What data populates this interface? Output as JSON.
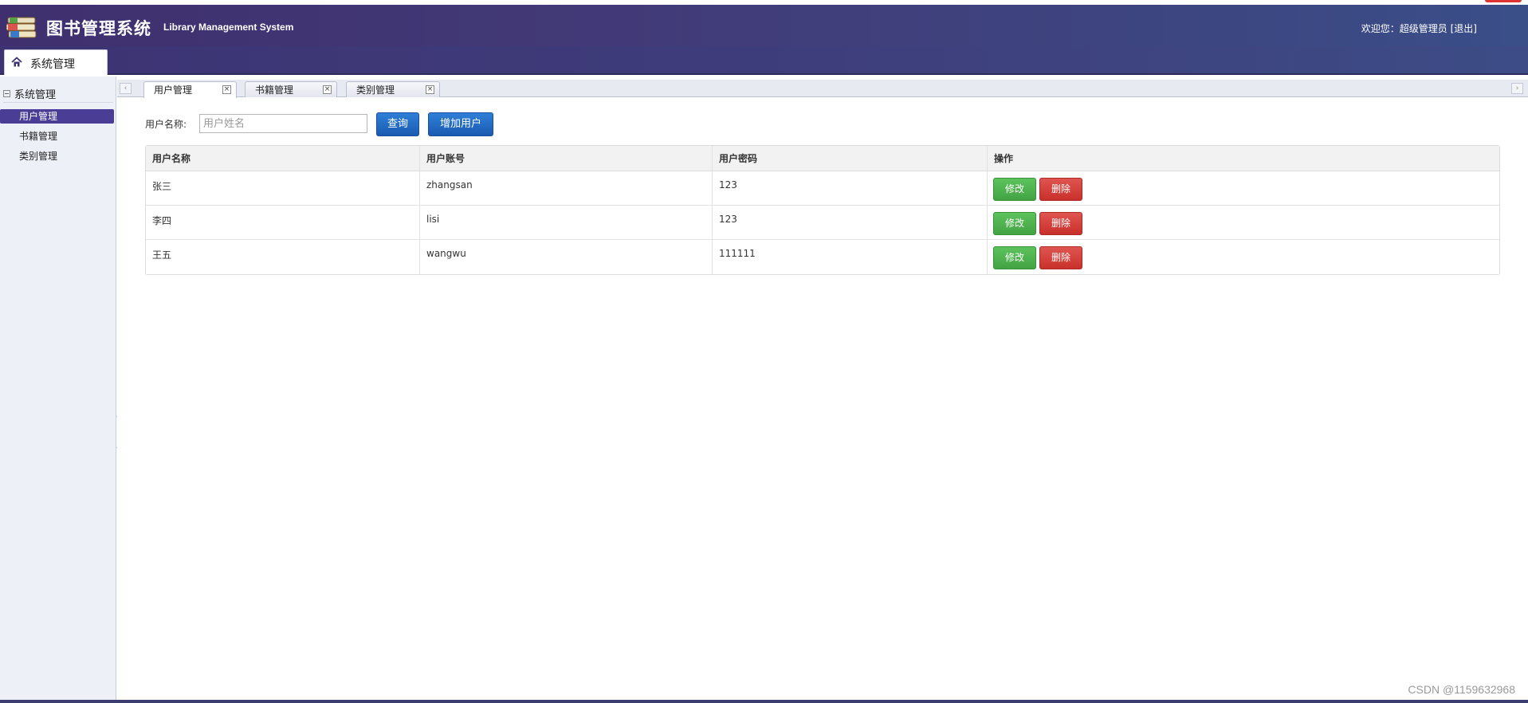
{
  "header": {
    "title": "图书管理系统",
    "subtitle": "Library Management System",
    "welcome_prefix": "欢迎您：",
    "user_name": "超级管理员",
    "logout_label": "[退出]"
  },
  "nav": {
    "tab_label": "系统管理"
  },
  "sidebar": {
    "group_label": "系统管理",
    "items": [
      {
        "label": "用户管理",
        "active": true
      },
      {
        "label": "书籍管理",
        "active": false
      },
      {
        "label": "类别管理",
        "active": false
      }
    ]
  },
  "tabs": [
    {
      "label": "用户管理",
      "active": true
    },
    {
      "label": "书籍管理",
      "active": false
    },
    {
      "label": "类别管理",
      "active": false
    }
  ],
  "close_glyph": "×",
  "search": {
    "label": "用户名称:",
    "placeholder": "用户姓名",
    "query_button": "查询",
    "add_button": "增加用户"
  },
  "table": {
    "columns": [
      "用户名称",
      "用户账号",
      "用户密码",
      "操作"
    ],
    "rows": [
      {
        "name": "张三",
        "account": "zhangsan",
        "password": "123"
      },
      {
        "name": "李四",
        "account": "lisi",
        "password": "123"
      },
      {
        "name": "王五",
        "account": "wangwu",
        "password": "111111"
      }
    ],
    "edit_label": "修改",
    "delete_label": "删除"
  },
  "watermark": "CSDN @1159632968",
  "colors": {
    "header_bg": "#423a78",
    "active_menu": "#4a3d96",
    "primary_button": "#1b5bb2",
    "edit_button": "#43a343",
    "delete_button": "#c9302c"
  }
}
